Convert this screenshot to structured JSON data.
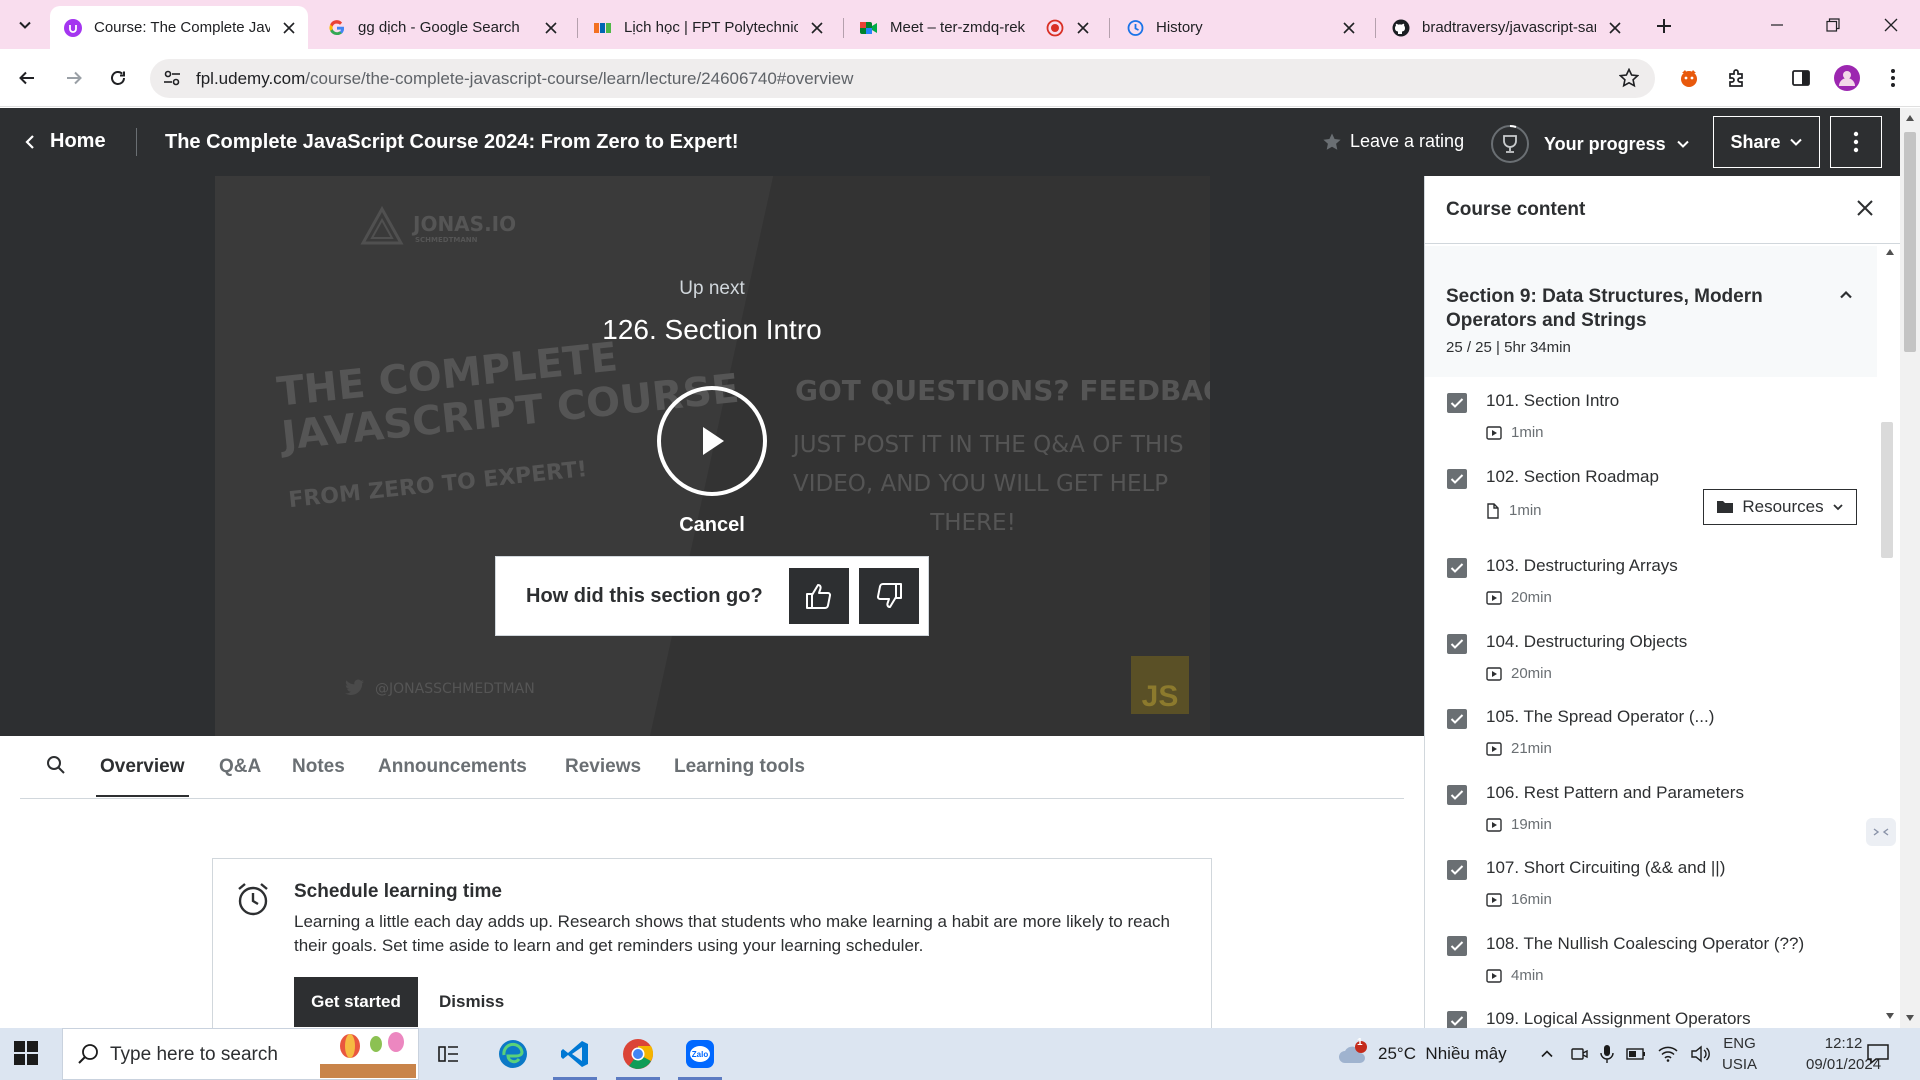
{
  "browser": {
    "tabs": [
      {
        "title": "Course: The Complete Java",
        "active": true
      },
      {
        "title": "gg dịch - Google Search",
        "active": false
      },
      {
        "title": "Lịch học | FPT Polytechnic",
        "active": false
      },
      {
        "title": "Meet – ter-zmdq-rek",
        "active": false
      },
      {
        "title": "History",
        "active": false
      },
      {
        "title": "bradtraversy/javascript-san",
        "active": false
      }
    ],
    "url_host": "fpl.udemy.com",
    "url_path": "/course/the-complete-javascript-course/learn/lecture/24606740#overview"
  },
  "header": {
    "home_label": "Home",
    "course_title": "The Complete JavaScript Course 2024: From Zero to Expert!",
    "rating_label": "Leave a rating",
    "progress_label": "Your progress",
    "share_label": "Share"
  },
  "player": {
    "slide_text": {
      "brand": "JONAS.IO",
      "brand_sub": "SCHMEDTMANN",
      "title_line1": "THE COMPLETE",
      "title_line2": "JAVASCRIPT COURSE",
      "subtitle": "FROM ZERO TO EXPERT!",
      "q_title": "GOT QUESTIONS? FEEDBACK?",
      "q_line1": "JUST POST IT IN THE Q&A OF THIS",
      "q_line2": "VIDEO, AND YOU WILL GET HELP",
      "q_line3": "THERE!",
      "twitter": "@JONASSCHMEDTMAN",
      "js_badge": "JS"
    },
    "up_next_label": "Up next",
    "next_title": "126. Section Intro",
    "cancel_label": "Cancel",
    "feedback_question": "How did this section go?"
  },
  "content_tabs": [
    "Overview",
    "Q&A",
    "Notes",
    "Announcements",
    "Reviews",
    "Learning tools"
  ],
  "schedule": {
    "heading": "Schedule learning time",
    "text": "Learning a little each day adds up. Research shows that students who make learning a habit are more likely to reach their goals. Set time aside to learn and get reminders using your learning scheduler.",
    "primary_button": "Get started",
    "secondary_button": "Dismiss"
  },
  "sidebar": {
    "title": "Course content",
    "section_title": "Section 9: Data Structures, Modern Operators and Strings",
    "section_meta": "25 / 25 | 5hr 34min",
    "resources_label": "Resources",
    "lectures": [
      {
        "title": "101. Section Intro",
        "duration": "1min",
        "kind": "video",
        "checked": true
      },
      {
        "title": "102. Section Roadmap",
        "duration": "1min",
        "kind": "file",
        "checked": true
      },
      {
        "title": "103. Destructuring Arrays",
        "duration": "20min",
        "kind": "video",
        "checked": true
      },
      {
        "title": "104. Destructuring Objects",
        "duration": "20min",
        "kind": "video",
        "checked": true
      },
      {
        "title": "105. The Spread Operator (...)",
        "duration": "21min",
        "kind": "video",
        "checked": true
      },
      {
        "title": "106. Rest Pattern and Parameters",
        "duration": "19min",
        "kind": "video",
        "checked": true
      },
      {
        "title": "107. Short Circuiting (&& and ||)",
        "duration": "16min",
        "kind": "video",
        "checked": true
      },
      {
        "title": "108. The Nullish Coalescing Operator (??)",
        "duration": "4min",
        "kind": "video",
        "checked": true
      },
      {
        "title": "109. Logical Assignment Operators",
        "duration": "",
        "kind": "video",
        "checked": true
      }
    ]
  },
  "taskbar": {
    "search_placeholder": "Type here to search",
    "weather_badge": "1",
    "weather": "25°C  Nhiều mây",
    "lang_line1": "ENG",
    "lang_line2": "USIA",
    "time": "12:12",
    "date": "09/01/2024"
  },
  "colors": {
    "tabbar_bg": "#f9ddee",
    "udemy_dark": "#2d2f31",
    "taskbar_bg": "#dce5f1"
  }
}
